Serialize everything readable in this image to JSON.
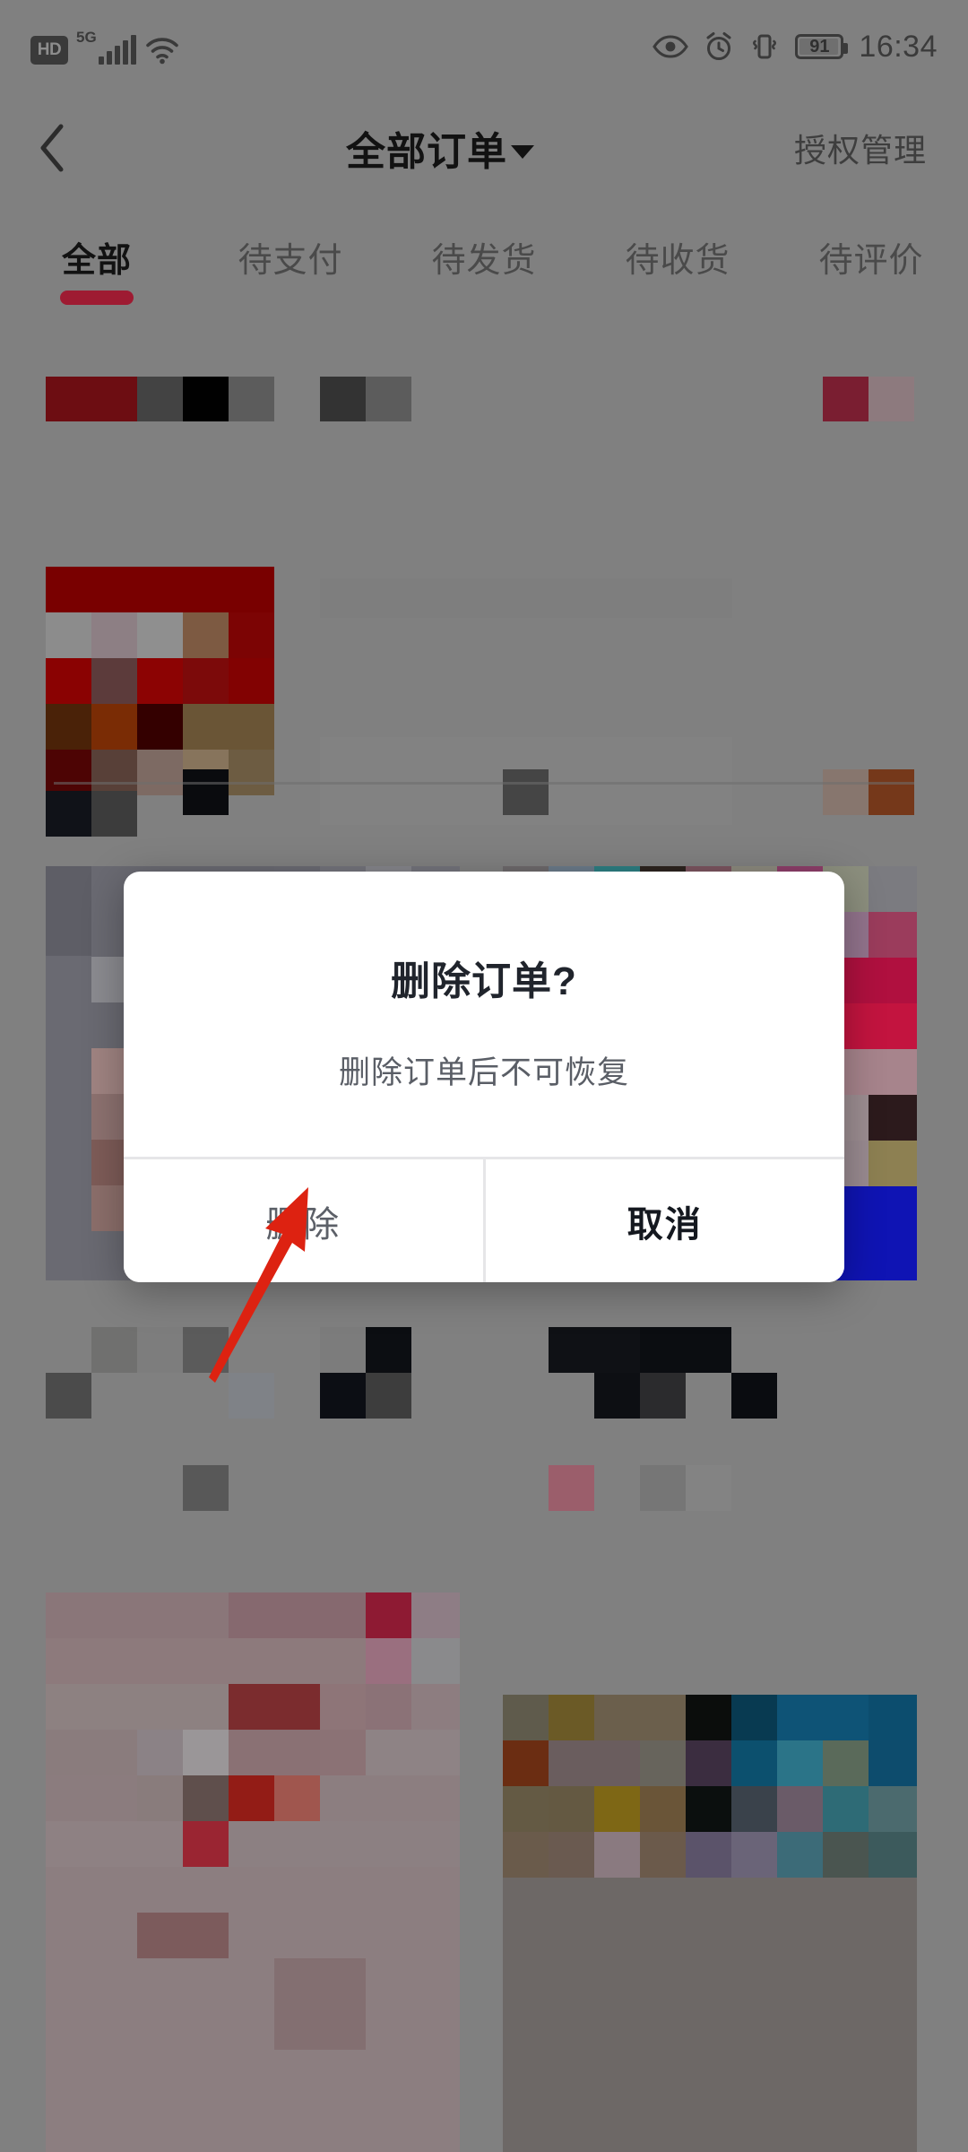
{
  "status_bar": {
    "hd_label": "HD",
    "network_generation": "5G",
    "signal_icon": "signal-bars-icon",
    "wifi_icon": "wifi-icon",
    "eye_comfort_icon": "eye-icon",
    "alarm_icon": "alarm-clock-icon",
    "vibrate_icon": "vibrate-icon",
    "battery_icon": "battery-icon",
    "battery_level": "91",
    "time": "16:34"
  },
  "nav": {
    "back_icon": "back-chevron-icon",
    "title": "全部订单",
    "caret_icon": "chevron-down-icon",
    "action_label": "授权管理"
  },
  "tabs": {
    "active_index": 0,
    "items": [
      {
        "label": "全部"
      },
      {
        "label": "待支付"
      },
      {
        "label": "待发货"
      },
      {
        "label": "待收货"
      },
      {
        "label": "待评价"
      }
    ]
  },
  "dialog": {
    "title": "删除订单?",
    "message": "删除订单后不可恢复",
    "confirm_label": "删除",
    "cancel_label": "取消"
  },
  "annotation": {
    "arrow_icon": "red-arrow-annotation",
    "points_at": "删除"
  },
  "colors": {
    "accent_red": "#9e1b32",
    "annotation_red": "#dd2211",
    "dim_overlay": "#808080",
    "dialog_bg": "#ffffff",
    "title_text": "#20242c",
    "message_text": "#5a5e66"
  }
}
